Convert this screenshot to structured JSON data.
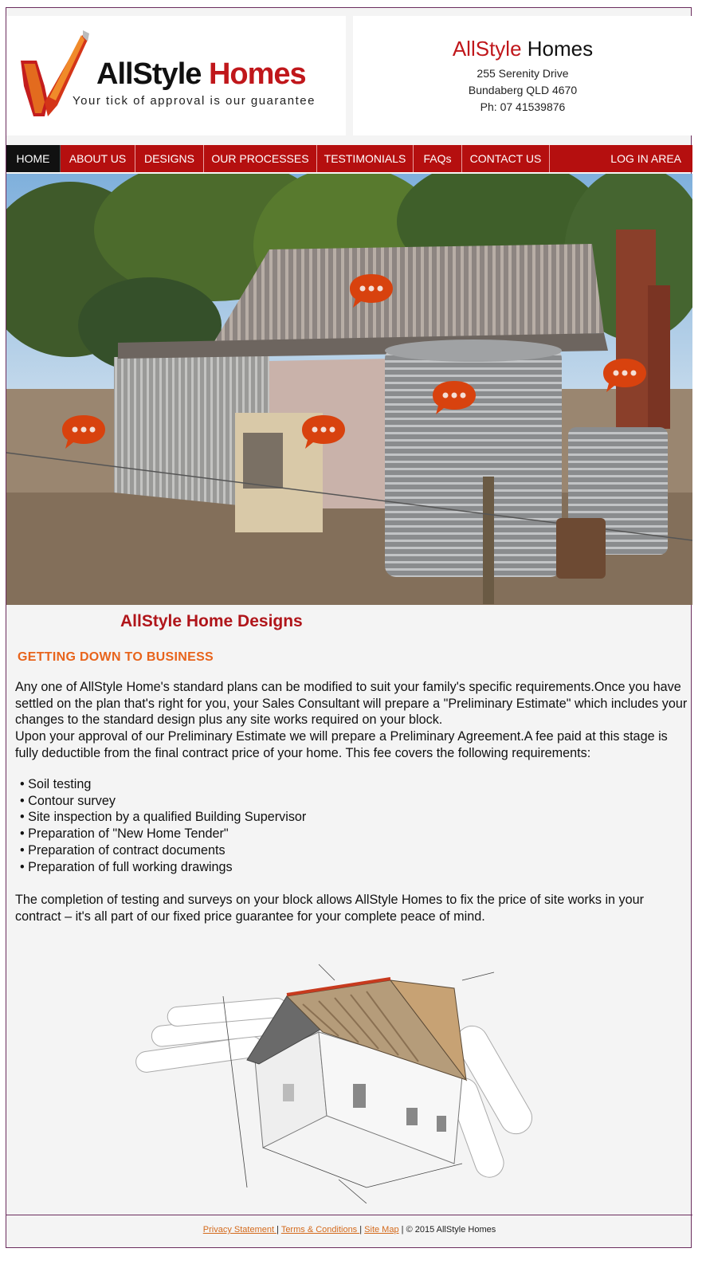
{
  "header": {
    "logo_word1": "AllStyle",
    "logo_word2": "Homes",
    "tagline": "Your tick of approval is our guarantee",
    "brand_word1": "AllStyle",
    "brand_word2": "Homes",
    "address_line1": "255 Serenity Drive",
    "address_line2": "Bundaberg QLD 4670",
    "phone": "Ph: 07 41539876"
  },
  "nav": {
    "items": [
      {
        "label": "HOME",
        "active": true
      },
      {
        "label": "ABOUT US"
      },
      {
        "label": "DESIGNS"
      },
      {
        "label": "OUR PROCESSES"
      },
      {
        "label": "TESTIMONIALS"
      },
      {
        "label": "FAQs"
      },
      {
        "label": "CONTACT US"
      }
    ],
    "login": "LOG IN AREA"
  },
  "main": {
    "title": "AllStyle Home Designs",
    "section_title": "GETTING DOWN TO BUSINESS",
    "para1": "Any one of AllStyle Home's standard plans can be modified to suit your family's specific requirements.Once you have settled on the plan that's right for you, your Sales Consultant will prepare a \"Preliminary Estimate\" which includes your changes to the standard design plus any site works required on your block.",
    "para2": "Upon your approval of our Preliminary Estimate we will prepare a Preliminary Agreement.A fee paid at this stage is fully deductible from the final contract price of your home. This fee covers the following requirements:",
    "bullets": [
      "• Soil testing",
      "• Contour survey",
      "• Site inspection by a qualified Building Supervisor",
      "• Preparation of \"New Home Tender\"",
      "• Preparation of contract documents",
      "• Preparation of full working drawings"
    ],
    "para3": "The completion of testing and surveys on your block allows AllStyle Homes to fix the price of site works in your contract – it's all part of our fixed price guarantee for your complete peace of mind."
  },
  "footer": {
    "privacy": "Privacy Statement ",
    "sep1": " | ",
    "terms": "Terms & Conditions ",
    "sep2": " | ",
    "sitemap": "Site Map",
    "copyright": " | © 2015 AllStyle Homes"
  },
  "colors": {
    "brand_red": "#b50f0f",
    "accent_orange": "#e8641c",
    "bubble_orange": "#d8420e"
  },
  "icons": {
    "logo": "checkmark-icon",
    "hotspot": "speech-bubble-icon"
  }
}
